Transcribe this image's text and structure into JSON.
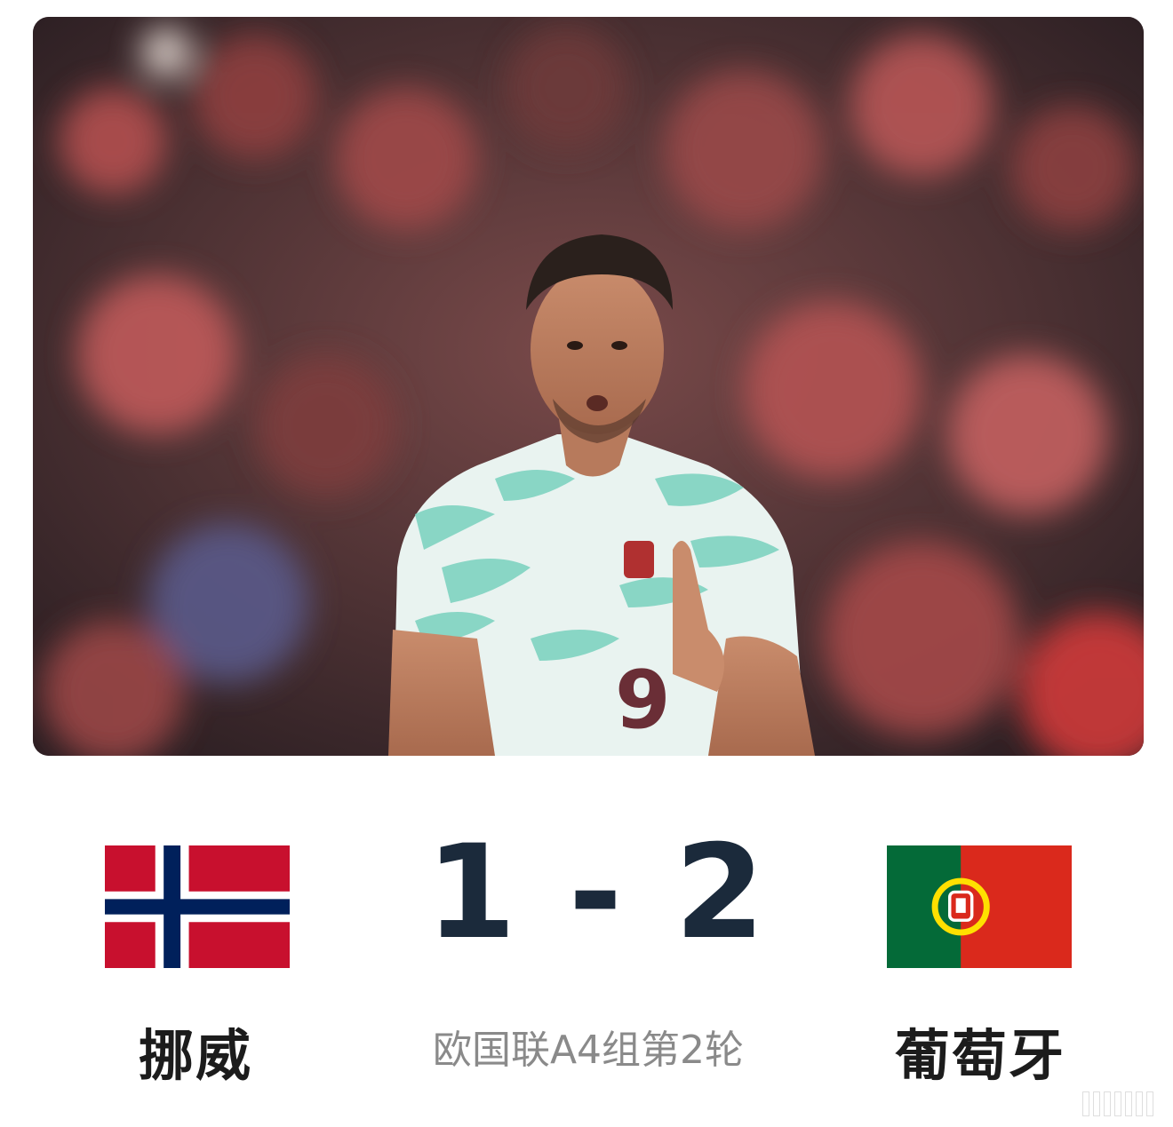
{
  "match": {
    "home_team": "挪威",
    "away_team": "葡萄牙",
    "score": "1 - 2",
    "home_score": 1,
    "away_score": 2,
    "competition": "欧国联A4组第2轮"
  },
  "hero_image": {
    "subject": "footballer-photo",
    "shirt_number": "9"
  },
  "icons": {
    "home_flag": "norway-flag-icon",
    "away_flag": "portugal-flag-icon"
  },
  "colors": {
    "score": "#1b2a3b",
    "norway_red": "#c8102e",
    "norway_blue": "#00205b",
    "portugal_green": "#046a38",
    "portugal_red": "#da291c",
    "jersey_mint": "#7fd3c1"
  }
}
